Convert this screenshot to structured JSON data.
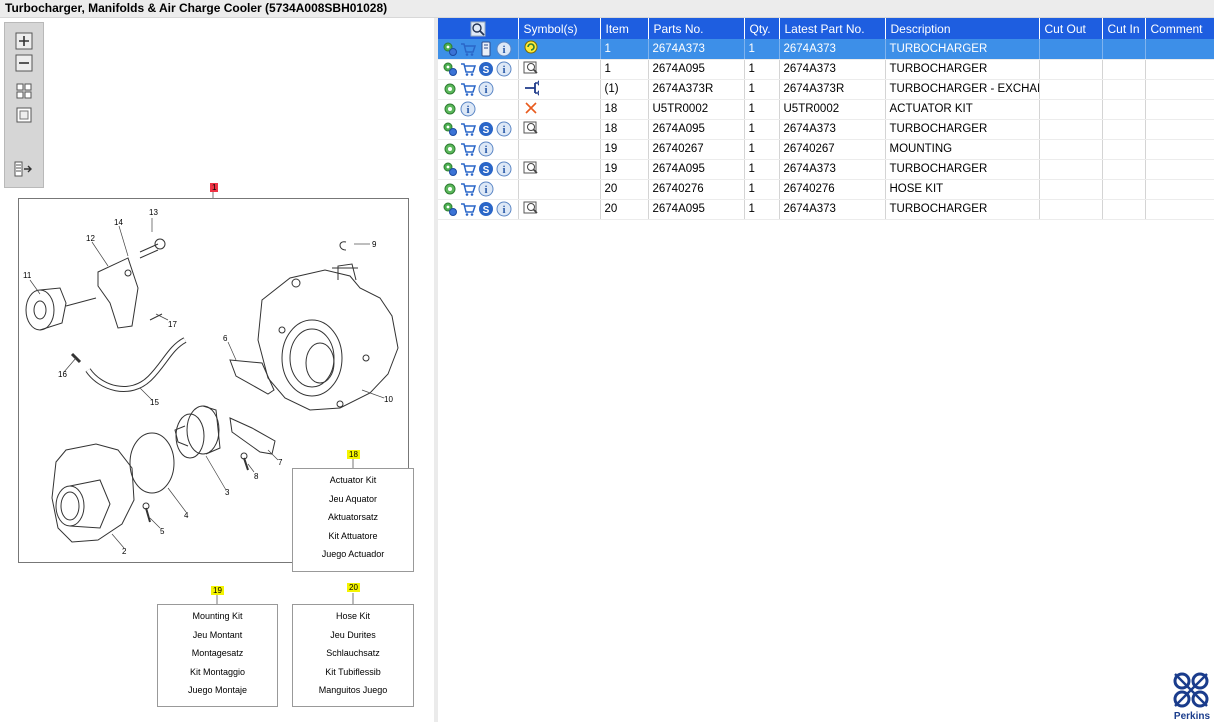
{
  "window": {
    "title": "Turbocharger, Manifolds & Air Charge Cooler (5734A008SBH01028)"
  },
  "toolbar": {
    "buttons": [
      {
        "name": "zoom-in-icon"
      },
      {
        "name": "zoom-out-icon"
      },
      {
        "name": "fit-all-icon"
      },
      {
        "name": "fit-page-icon"
      },
      {
        "name": "list-toggle-icon"
      }
    ]
  },
  "diagram": {
    "main_callout": "1",
    "numbers": [
      "13",
      "14",
      "12",
      "11",
      "17",
      "16",
      "15",
      "6",
      "9",
      "10",
      "3",
      "4",
      "2",
      "5",
      "8",
      "7"
    ],
    "kits": [
      {
        "tag": "18",
        "lines": [
          "Actuator Kit",
          "Jeu Aquator",
          "Aktuatorsatz",
          "Kit Attuatore",
          "Juego Actuador"
        ]
      },
      {
        "tag": "19",
        "lines": [
          "Mounting Kit",
          "Jeu Montant",
          "Montagesatz",
          "Kit Montaggio",
          "Juego Montaje"
        ]
      },
      {
        "tag": "20",
        "lines": [
          "Hose Kit",
          "Jeu Durites",
          "Schlauchsatz",
          "Kit Tubiflessib",
          "Manguitos Juego"
        ]
      }
    ]
  },
  "table": {
    "columns": [
      "Symbol(s)",
      "Item",
      "Parts No.",
      "Qty.",
      "Latest Part No.",
      "Description",
      "Cut Out",
      "Cut In",
      "Comment"
    ],
    "rows": [
      {
        "item": "1",
        "part": "2674A373",
        "qty": "1",
        "latest": "2674A373",
        "desc": "TURBOCHARGER",
        "cut_out": "",
        "cut_in": "",
        "comment": "",
        "icons": [
          "gear-blue",
          "cart",
          "book",
          "info"
        ],
        "symbol": "revision"
      },
      {
        "item": "1",
        "part": "2674A095",
        "qty": "1",
        "latest": "2674A373",
        "desc": "TURBOCHARGER",
        "cut_out": "",
        "cut_in": "",
        "comment": "",
        "icons": [
          "gear-blue",
          "cart",
          "s",
          "info"
        ],
        "symbol": "view"
      },
      {
        "item": "(1)",
        "part": "2674A373R",
        "qty": "1",
        "latest": "2674A373R",
        "desc": "TURBOCHARGER - EXCHANGE",
        "cut_out": "",
        "cut_in": "",
        "comment": "",
        "icons": [
          "gear-green",
          "cart",
          "info"
        ],
        "symbol": "exchange"
      },
      {
        "item": "18",
        "part": "U5TR0002",
        "qty": "1",
        "latest": "U5TR0002",
        "desc": "ACTUATOR KIT",
        "cut_out": "",
        "cut_in": "",
        "comment": "",
        "icons": [
          "gear-green",
          "info"
        ],
        "symbol": "cross"
      },
      {
        "item": "18",
        "part": "2674A095",
        "qty": "1",
        "latest": "2674A373",
        "desc": "TURBOCHARGER",
        "cut_out": "",
        "cut_in": "",
        "comment": "",
        "icons": [
          "gear-blue",
          "cart",
          "s",
          "info"
        ],
        "symbol": "view"
      },
      {
        "item": "19",
        "part": "26740267",
        "qty": "1",
        "latest": "26740267",
        "desc": "MOUNTING",
        "cut_out": "",
        "cut_in": "",
        "comment": "",
        "icons": [
          "gear-green",
          "cart",
          "info"
        ],
        "symbol": ""
      },
      {
        "item": "19",
        "part": "2674A095",
        "qty": "1",
        "latest": "2674A373",
        "desc": "TURBOCHARGER",
        "cut_out": "",
        "cut_in": "",
        "comment": "",
        "icons": [
          "gear-blue",
          "cart",
          "s",
          "info"
        ],
        "symbol": "view"
      },
      {
        "item": "20",
        "part": "26740276",
        "qty": "1",
        "latest": "26740276",
        "desc": "HOSE KIT",
        "cut_out": "",
        "cut_in": "",
        "comment": "",
        "icons": [
          "gear-green",
          "cart",
          "info"
        ],
        "symbol": ""
      },
      {
        "item": "20",
        "part": "2674A095",
        "qty": "1",
        "latest": "2674A373",
        "desc": "TURBOCHARGER",
        "cut_out": "",
        "cut_in": "",
        "comment": "",
        "icons": [
          "gear-blue",
          "cart",
          "s",
          "info"
        ],
        "symbol": "view"
      }
    ],
    "selected_row": 0
  },
  "brand": {
    "name": "Perkins",
    "color": "#1a3c8c"
  },
  "colors": {
    "header": "#1e5ee0",
    "selected": "#3d8fe8",
    "callout_red": "#ee3344",
    "callout_yellow": "#f4f400"
  }
}
